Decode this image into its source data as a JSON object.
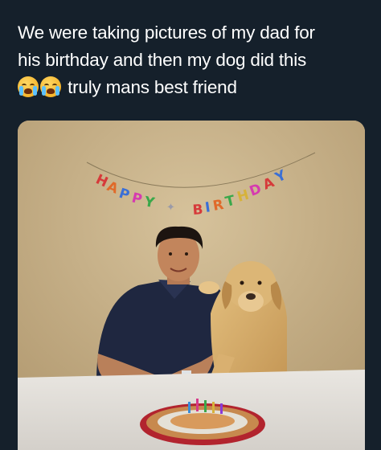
{
  "post": {
    "caption_line_1": "We were taking pictures of my dad for",
    "caption_line_2": "his birthday and then my dog did this",
    "caption_line_3": "truly mans best friend",
    "emojis": [
      "loudly-crying-face",
      "loudly-crying-face"
    ]
  },
  "photo": {
    "banner_text": "HAPPY BIRTHDAY",
    "subject": "man with yellow labrador at birthday table with cookie cake"
  }
}
